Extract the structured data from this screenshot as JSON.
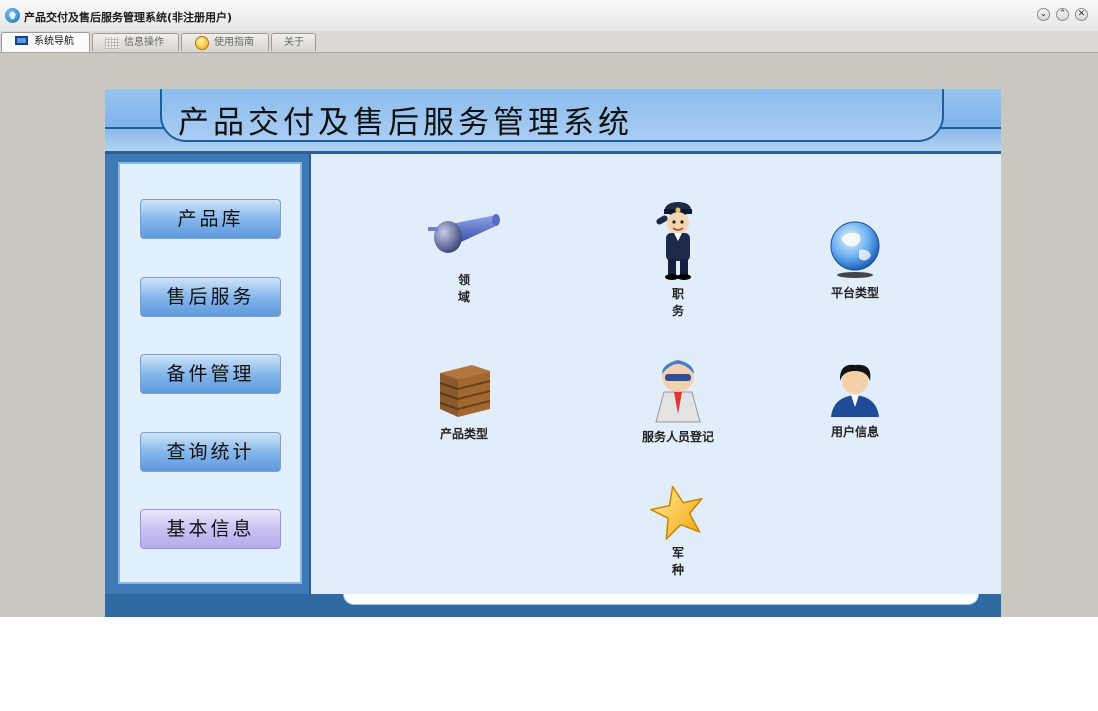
{
  "window": {
    "title": "产品交付及售后服务管理系统(非注册用户)",
    "controls": [
      "⌄",
      "⌃",
      "✕"
    ]
  },
  "tabs": [
    {
      "label": "系统导航",
      "icon": "monitor-icon",
      "active": true
    },
    {
      "label": "信息操作",
      "icon": "grid-icon",
      "active": false
    },
    {
      "label": "使用指南",
      "icon": "smiley-icon",
      "active": false
    },
    {
      "label": "关于",
      "icon": "",
      "active": false
    }
  ],
  "banner": {
    "title": "产品交付及售后服务管理系统"
  },
  "sidebar": {
    "items": [
      {
        "label": "产品库"
      },
      {
        "label": "售后服务"
      },
      {
        "label": "备件管理"
      },
      {
        "label": "查询统计"
      },
      {
        "label": "基本信息"
      }
    ]
  },
  "main": {
    "items": [
      {
        "label": "领　　域",
        "icon": "telescope-icon"
      },
      {
        "label": "职　　务",
        "icon": "police-officer-icon"
      },
      {
        "label": "平台类型",
        "icon": "globe-icon"
      },
      {
        "label": "产品类型",
        "icon": "wooden-crate-icon"
      },
      {
        "label": "服务人员登记",
        "icon": "service-person-icon"
      },
      {
        "label": "用户信息",
        "icon": "user-icon"
      },
      {
        "label": "军　　种",
        "icon": "star-icon"
      }
    ]
  },
  "colors": {
    "accent": "#3e79b6",
    "header": "#8cbdef",
    "content_bg": "#e1edfb"
  }
}
